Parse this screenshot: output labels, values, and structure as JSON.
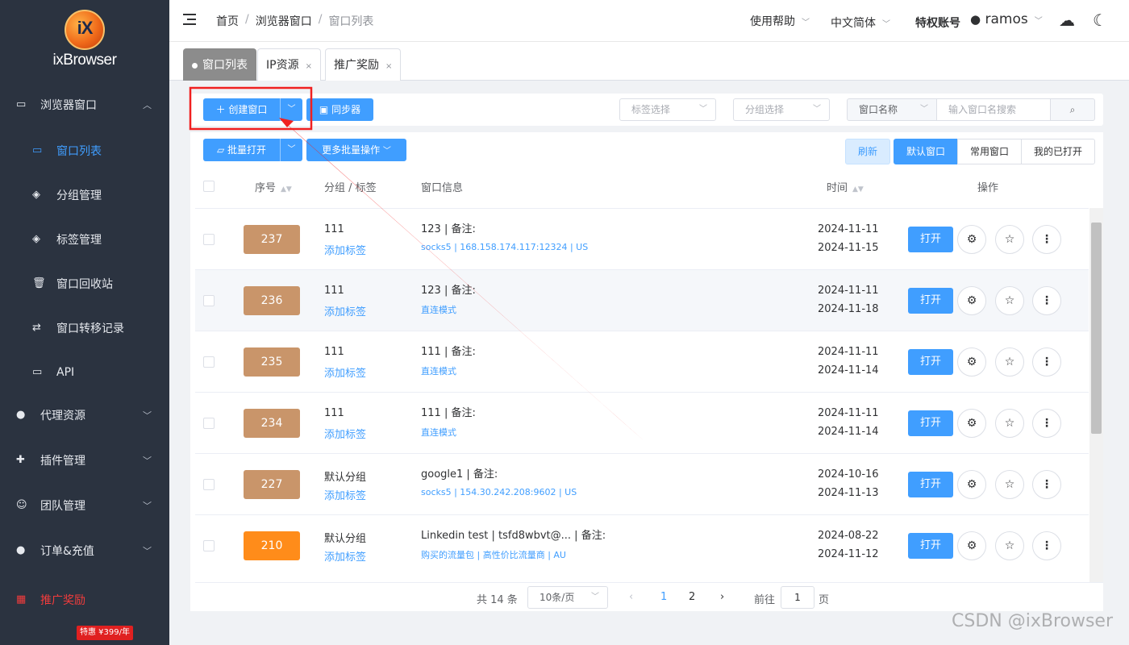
{
  "app": {
    "logo_mark": "iX",
    "logo_text": "ixBrowser"
  },
  "sidebar": {
    "items": [
      {
        "label": "浏览器窗口",
        "icon": "browser-window-icon"
      },
      {
        "label": "窗口列表",
        "icon": "window-list-icon"
      },
      {
        "label": "分组管理",
        "icon": "layers-icon"
      },
      {
        "label": "标签管理",
        "icon": "layers-icon"
      },
      {
        "label": "窗口回收站",
        "icon": "trash-icon"
      },
      {
        "label": "窗口转移记录",
        "icon": "transfer-icon"
      },
      {
        "label": "API",
        "icon": "api-icon"
      },
      {
        "label": "代理资源",
        "icon": "globe-icon"
      },
      {
        "label": "插件管理",
        "icon": "puzzle-icon"
      },
      {
        "label": "团队管理",
        "icon": "team-icon"
      },
      {
        "label": "订单&充值",
        "icon": "coin-icon"
      },
      {
        "label": "推广奖励",
        "icon": "gift-icon"
      }
    ],
    "promo_badge": "特惠 ¥399/年"
  },
  "header": {
    "breadcrumb": [
      "首页",
      "浏览器窗口",
      "窗口列表"
    ],
    "help": "使用帮助",
    "language": "中文简体",
    "account_type": "特权账号",
    "username": "ramos"
  },
  "tabs": [
    {
      "label": "窗口列表"
    },
    {
      "label": "IP资源"
    },
    {
      "label": "推广奖励"
    }
  ],
  "toolbar": {
    "create_label": "＋ 创建窗口",
    "sync_label": "同步器",
    "tag_select_placeholder": "标签选择",
    "group_select_placeholder": "分组选择",
    "search_field_type": "窗口名称",
    "search_placeholder": "输入窗口名搜索",
    "batch_open_label": "批量打开",
    "more_batch_label": "更多批量操作",
    "refresh_label": "刷新",
    "views": [
      "默认窗口",
      "常用窗口",
      "我的已打开"
    ]
  },
  "table": {
    "headers": {
      "index": "序号",
      "group": "分组 / 标签",
      "info": "窗口信息",
      "time": "时间",
      "ops": "操作"
    },
    "open_label": "打开",
    "add_tag_label": "添加标签",
    "rows": [
      {
        "id": "237",
        "group": "111",
        "info": "123 | 备注:",
        "proxy": "socks5  | 168.158.174.117:12324  | US",
        "created": "2024-11-11",
        "updated": "2024-11-15",
        "color": "#c9956a"
      },
      {
        "id": "236",
        "group": "111",
        "info": "123 | 备注:",
        "proxy": "直连模式",
        "created": "2024-11-11",
        "updated": "2024-11-18",
        "color": "#c9956a"
      },
      {
        "id": "235",
        "group": "111",
        "info": "111 | 备注:",
        "proxy": "直连模式",
        "created": "2024-11-11",
        "updated": "2024-11-14",
        "color": "#c9956a"
      },
      {
        "id": "234",
        "group": "111",
        "info": "111 | 备注:",
        "proxy": "直连模式",
        "created": "2024-11-11",
        "updated": "2024-11-14",
        "color": "#c9956a"
      },
      {
        "id": "227",
        "group": "默认分组",
        "info": "google1 | 备注:",
        "proxy": "socks5  | 154.30.242.208:9602  | US",
        "created": "2024-10-16",
        "updated": "2024-11-13",
        "color": "#c9956a"
      },
      {
        "id": "210",
        "group": "默认分组",
        "info": "Linkedin test | tsfd8wbvt@... | 备注:",
        "proxy": "购买的流量包  | 高性价比流量商  | AU",
        "created": "2024-08-22",
        "updated": "2024-11-12",
        "color": "#ff8c1a"
      }
    ]
  },
  "pagination": {
    "total": "共 14 条",
    "page_size": "10条/页",
    "pages": [
      "1",
      "2"
    ],
    "goto_label": "前往",
    "goto_value": "1",
    "goto_suffix": "页"
  },
  "watermark": "CSDN @ixBrowser",
  "colors": {
    "primary": "#409eff",
    "sidebar_bg": "#2b3340",
    "annotation_red": "#f02020",
    "promo_red": "#f23c3c"
  }
}
